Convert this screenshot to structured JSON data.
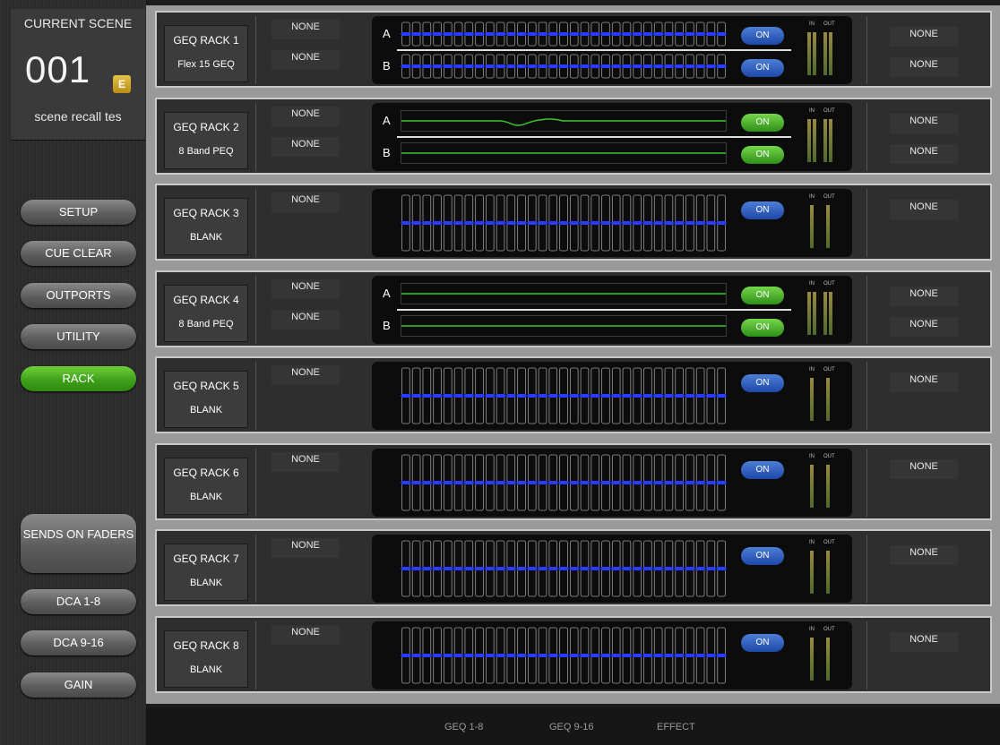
{
  "scene": {
    "title": "CURRENT SCENE",
    "number": "001",
    "badge": "E",
    "name": "scene recall tes"
  },
  "sidebar": {
    "buttons": [
      {
        "label": "SETUP",
        "active": false
      },
      {
        "label": "CUE CLEAR",
        "active": false
      },
      {
        "label": "OUTPORTS",
        "active": false
      },
      {
        "label": "UTILITY",
        "active": false
      },
      {
        "label": "RACK",
        "active": true
      }
    ],
    "lower_buttons": [
      {
        "label": "SENDS ON FADERS"
      },
      {
        "label": "DCA 1-8"
      },
      {
        "label": "DCA 9-16"
      },
      {
        "label": "GAIN"
      }
    ]
  },
  "racks": [
    {
      "name": "GEQ RACK 1",
      "type": "Flex 15 GEQ",
      "mode": "geq-dual",
      "inputs": [
        "NONE",
        "NONE"
      ],
      "outputs": [
        "NONE",
        "NONE"
      ],
      "row_labels": [
        "A",
        "B"
      ],
      "on_label": "ON"
    },
    {
      "name": "GEQ RACK 2",
      "type": "8 Band PEQ",
      "mode": "peq-dual",
      "inputs": [
        "NONE",
        "NONE"
      ],
      "outputs": [
        "NONE",
        "NONE"
      ],
      "row_labels": [
        "A",
        "B"
      ],
      "on_label": "ON"
    },
    {
      "name": "GEQ RACK 3",
      "type": "BLANK",
      "mode": "geq-single",
      "inputs": [
        "NONE"
      ],
      "outputs": [
        "NONE"
      ],
      "row_labels": [],
      "on_label": "ON"
    },
    {
      "name": "GEQ RACK 4",
      "type": "8 Band PEQ",
      "mode": "peq-dual",
      "inputs": [
        "NONE",
        "NONE"
      ],
      "outputs": [
        "NONE",
        "NONE"
      ],
      "row_labels": [
        "A",
        "B"
      ],
      "on_label": "ON"
    },
    {
      "name": "GEQ RACK 5",
      "type": "BLANK",
      "mode": "geq-single",
      "inputs": [
        "NONE"
      ],
      "outputs": [
        "NONE"
      ],
      "row_labels": [],
      "on_label": "ON"
    },
    {
      "name": "GEQ RACK 6",
      "type": "BLANK",
      "mode": "geq-single",
      "inputs": [
        "NONE"
      ],
      "outputs": [
        "NONE"
      ],
      "row_labels": [],
      "on_label": "ON"
    },
    {
      "name": "GEQ RACK 7",
      "type": "BLANK",
      "mode": "geq-single",
      "inputs": [
        "NONE"
      ],
      "outputs": [
        "NONE"
      ],
      "row_labels": [],
      "on_label": "ON"
    },
    {
      "name": "GEQ RACK 8",
      "type": "BLANK",
      "mode": "geq-single",
      "inputs": [
        "NONE"
      ],
      "outputs": [
        "NONE"
      ],
      "row_labels": [],
      "on_label": "ON"
    }
  ],
  "meter_labels": {
    "in": "IN",
    "out": "OUT"
  },
  "tabs": [
    {
      "label": "GEQ 1-8",
      "active": true
    },
    {
      "label": "GEQ 9-16",
      "active": false
    },
    {
      "label": "EFFECT",
      "active": false
    }
  ],
  "colors": {
    "accent_blue": "#3e7ed8",
    "active_green": "#3fa01a",
    "fader_blue": "#2a3cff",
    "peq_curve": "#37c82a"
  }
}
